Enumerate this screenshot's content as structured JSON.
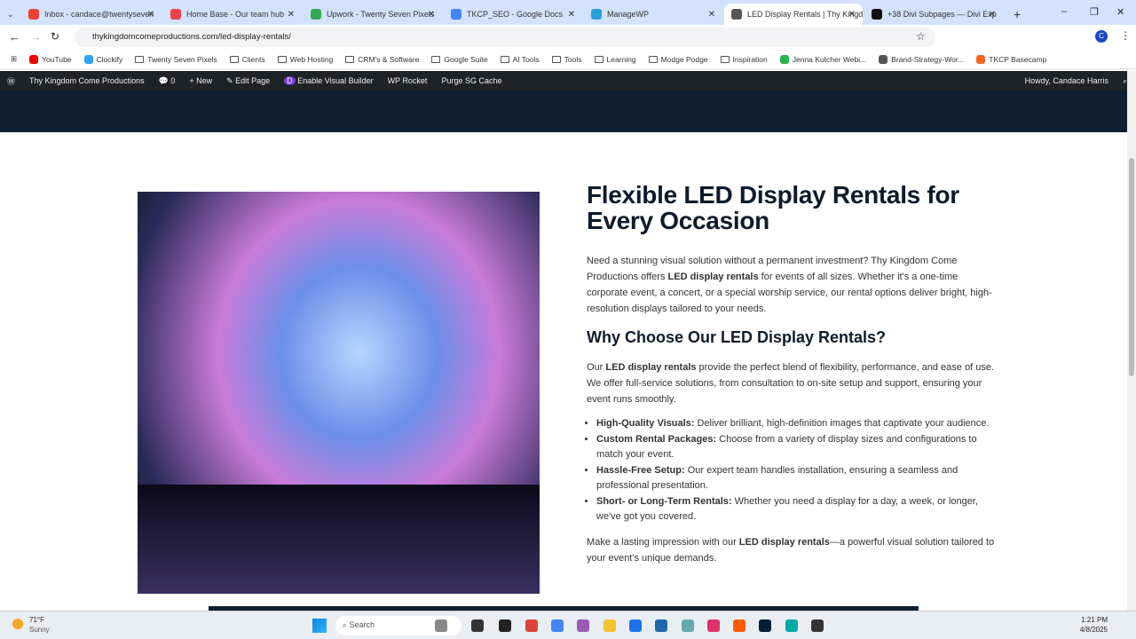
{
  "browser": {
    "tabs": [
      {
        "title": "Inbox - candace@twentyseven",
        "color": "#ea4335"
      },
      {
        "title": "Home Base - Our team hub",
        "color": "#e44"
      },
      {
        "title": "Upwork - Twenty Seven Pixels",
        "color": "#34a853"
      },
      {
        "title": "TKCP_SEO - Google Docs",
        "color": "#4285f4"
      },
      {
        "title": "ManageWP",
        "color": "#2a9fd6"
      },
      {
        "title": "LED Display Rentals | Thy Kingd",
        "color": "#555"
      },
      {
        "title": "+38 Divi Subpages — Divi Exp",
        "color": "#111"
      }
    ],
    "new_tab": "+",
    "url": "thykingdomcomeproductions.com/led-display-rentals/",
    "bookmarks": [
      "YouTube",
      "Clockify",
      "Twenty Seven Pixels",
      "Clients",
      "Web Hosting",
      "CRM's & Software",
      "Google Suite",
      "AI Tools",
      "Tools",
      "Learning",
      "Modge Podge",
      "Inspiration",
      "Jenna Kutcher Webi...",
      "Brand-Strategy-Wor...",
      "TKCP Basecamp"
    ]
  },
  "admin_bar": {
    "site": "Thy Kingdom Come Productions",
    "comments": "0",
    "new": "New",
    "edit": "Edit Page",
    "visual_builder": "Enable Visual Builder",
    "rocket": "WP Rocket",
    "purge": "Purge SG Cache",
    "howdy": "Howdy, Candace Harris"
  },
  "content": {
    "title": "Flexible LED Display Rentals for Every Occasion",
    "intro": [
      "Need a stunning visual solution without a permanent investment? Thy Kingdom Come Productions offers ",
      "LED display rentals",
      " for events of all sizes. Whether it's a one-time corporate event, a concert, or a special worship service, our rental options deliver bright, high-resolution displays tailored to your needs."
    ],
    "subtitle": "Why Choose Our LED Display Rentals?",
    "why": [
      "Our ",
      "LED display rentals",
      " provide the perfect blend of flexibility, performance, and ease of use. We offer full-service solutions, from consultation to on-site setup and support, ensuring your event runs smoothly."
    ],
    "bullets": [
      {
        "b": "High-Quality Visuals:",
        "t": " Deliver brilliant, high-definition images that captivate your audience."
      },
      {
        "b": "Custom Rental Packages:",
        "t": " Choose from a variety of display sizes and configurations to match your event."
      },
      {
        "b": "Hassle-Free Setup:",
        "t": " Our expert team handles installation, ensuring a seamless and professional presentation."
      },
      {
        "b": "Short- or Long-Term Rentals:",
        "t": " Whether you need a display for a day, a week, or longer, we've got you covered."
      }
    ],
    "closing": [
      "Make a lasting impression with our ",
      "LED display rentals",
      "—a powerful visual solution tailored to your event's unique demands."
    ]
  },
  "taskbar": {
    "temp": "71°F",
    "weather": "Sunny",
    "search": "Search",
    "time": "1:21 PM",
    "date": "4/8/2025"
  }
}
